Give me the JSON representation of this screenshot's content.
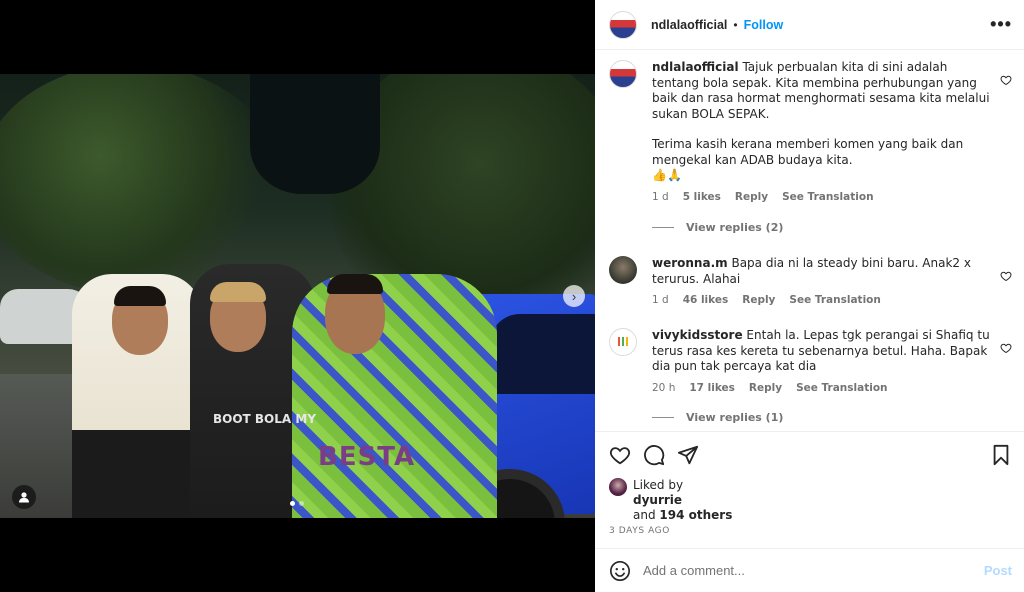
{
  "post": {
    "username": "ndlalaofficial",
    "follow_label": "Follow",
    "dot": "•",
    "more_label": "•••"
  },
  "photo": {
    "shirt_text_1": "BOOT BOLA MY",
    "shirt_text_2": "BESTA",
    "next_label": "›"
  },
  "comments": [
    {
      "username": "ndlalaofficial",
      "text_1": "Tajuk perbualan kita di sini adalah tentang bola sepak. Kita membina perhubungan yang baik dan rasa hormat menghormati sesama kita melalui sukan BOLA SEPAK.",
      "text_2": "Terima kasih kerana memberi komen yang baik dan mengekal kan ADAB budaya kita.",
      "text_3": "👍🙏",
      "time": "1 d",
      "likes": "5 likes",
      "reply": "Reply",
      "translate": "See Translation",
      "view_replies": "View replies (2)"
    },
    {
      "username": "weronna.m",
      "text_1": "Bapa dia ni la steady bini baru. Anak2 x terurus. Alahai",
      "time": "1 d",
      "likes": "46 likes",
      "reply": "Reply",
      "translate": "See Translation"
    },
    {
      "username": "vivykidsstore",
      "text_1": "Entah la. Lepas tgk perangai si Shafiq tu terus rasa kes kereta tu sebenarnya betul. Haha. Bapak dia pun tak percaya kat dia",
      "time": "20 h",
      "likes": "17 likes",
      "reply": "Reply",
      "translate": "See Translation",
      "view_replies": "View replies (1)"
    }
  ],
  "likes": {
    "liked_by": "Liked by",
    "liker": "dyurrie",
    "and": "and",
    "others": "194 others"
  },
  "posted": "3 DAYS AGO",
  "add_comment": {
    "placeholder": "Add a comment...",
    "post_label": "Post"
  },
  "colors": {
    "accent": "#0095f6",
    "post_disabled": "#b3dbff",
    "muted": "#737373"
  }
}
